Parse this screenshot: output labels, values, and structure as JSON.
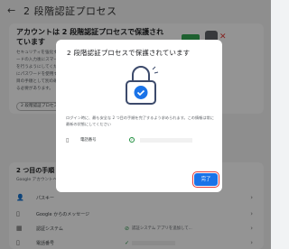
{
  "page": {
    "back_icon": "arrow-left-icon",
    "title": "2 段階認証プロセス"
  },
  "background": {
    "heading": "アカウントは 2 段階認証プロセスで保護されています",
    "para": "セキュリティを強化するため、パスワードの入力後にスマートフォンで確認を行うようにしてください。ログインにパスワードを使用する場合は、2 つ目の手順として別の確認方法を使用する必要があります。",
    "chip": "2 段階認証プロセス",
    "section_title": "2 つ目の手順",
    "section_sub": "Google アカウントへのログイン時に",
    "rows": [
      {
        "label": "パスキー",
        "icon": "person-key-icon"
      },
      {
        "label": "Google からのメッセージ",
        "icon": "phone-icon"
      },
      {
        "label": "認証システム",
        "icon": "grid-icon",
        "status": "認証システム アプリを追加して..."
      },
      {
        "label": "電話番号",
        "icon": "phone-icon"
      }
    ]
  },
  "dialog": {
    "title": "2 段階認証プロセスで保護されています",
    "para": "ログイン時に、最も安全な 2 つ目の手順を完了するよう求められます。この情報は常に最新の状態にしてください",
    "row": {
      "label": "電話番号",
      "icon": "phone-icon",
      "status_icon": "check-circle-icon"
    },
    "done_label": "完了"
  },
  "colors": {
    "accent": "#1a73e8",
    "lock": "#3c4a6b",
    "check": "#1e8e3e",
    "highlight": "#e53935"
  }
}
